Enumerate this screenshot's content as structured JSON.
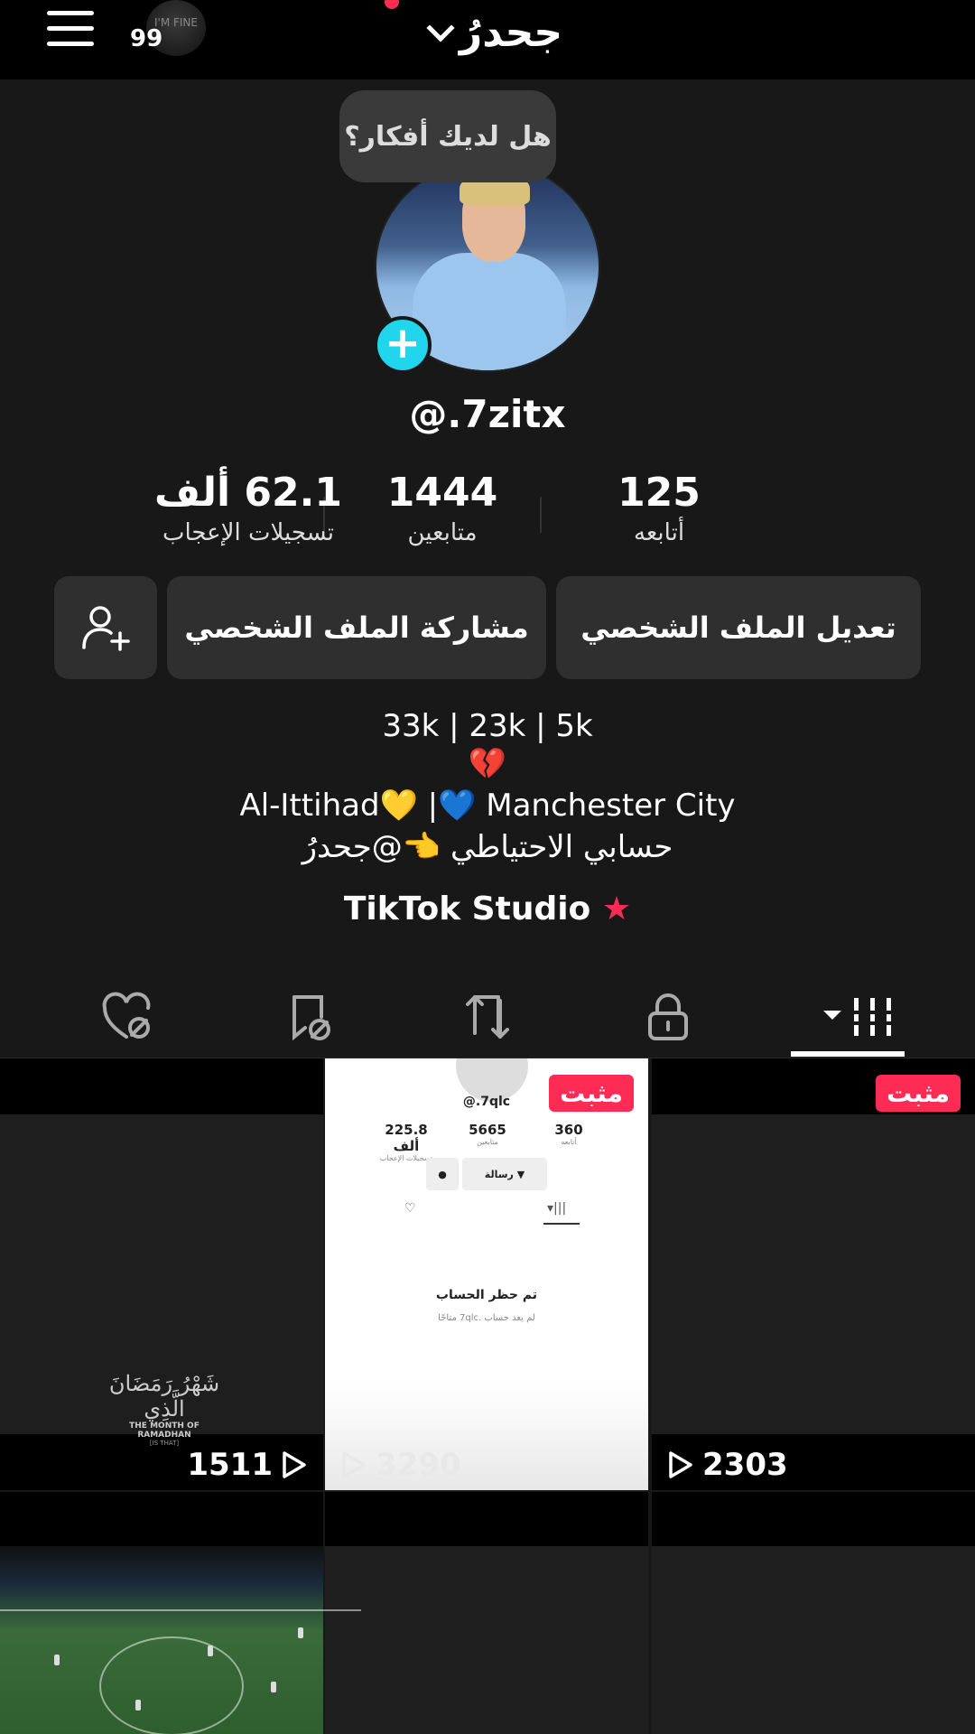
{
  "header": {
    "story_count": "99",
    "story_avatar_text": "I'M FINE",
    "account_name": "جحدرُ"
  },
  "profile": {
    "bubble_text": "هل لديك أفكار؟",
    "username": "@.7zitx",
    "stats": [
      {
        "value": "125",
        "label": "أتابعه"
      },
      {
        "value": "1444",
        "label": "متابعين"
      },
      {
        "value": "62.1 ألف",
        "label": "تسجيلات الإعجاب"
      }
    ],
    "buttons": {
      "edit": "تعديل الملف الشخصي",
      "share": "مشاركة الملف الشخصي"
    },
    "bio": {
      "line1": "33k | 23k | 5k",
      "line2": "💔",
      "line3": "Al-Ittihad💛 |💙 Manchester City",
      "line4": "حسابي الاحتياطي 👈@جحدرُ"
    },
    "studio": "TikTok Studio"
  },
  "tabs": [
    {
      "icon": "grid-videos-icon",
      "active": true
    },
    {
      "icon": "lock-icon",
      "active": false
    },
    {
      "icon": "repost-icon",
      "active": false
    },
    {
      "icon": "saved-hidden-icon",
      "active": false
    },
    {
      "icon": "liked-hidden-icon",
      "active": false
    }
  ],
  "grid": {
    "items": [
      {
        "pinned": "مثبت",
        "views": "2303"
      },
      {
        "pinned": "مثبت",
        "views": "3290"
      },
      {
        "views": "1511"
      }
    ],
    "ramadan": {
      "arabic": "شَهْرُ رَمَضَانَ الَّذِي",
      "english": "THE MONTH OF RAMADHAN",
      "sub": "[IS THAT]"
    },
    "screenshot": {
      "username": "@.7qlc",
      "stats": [
        {
          "value": "360",
          "label": "أتابعه"
        },
        {
          "value": "5665",
          "label": "متابعين"
        },
        {
          "value": "225.8 ألف",
          "label": "تسجيلات الإعجاب"
        }
      ],
      "message_button": "رسالة",
      "blocked_title": "تم حظر الحساب",
      "blocked_sub": "لم يعد حساب .7qlc متاحًا"
    }
  },
  "colors": {
    "accent": "#fe2c55",
    "plus_badge": "#20d5ec",
    "background": "#181818"
  }
}
